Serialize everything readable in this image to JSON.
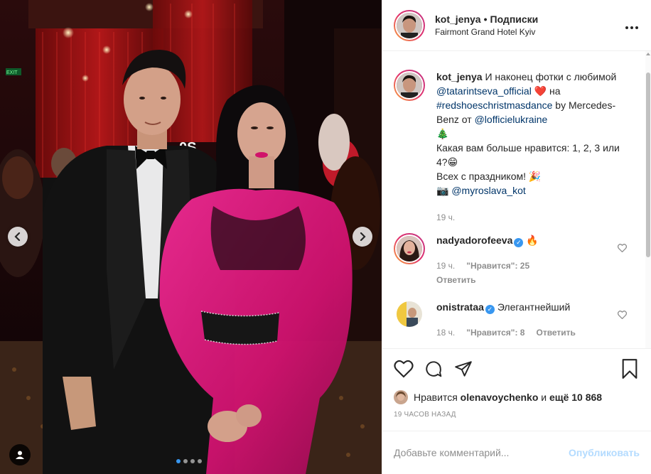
{
  "photo": {
    "alt_sign": "0S",
    "exit_sign": "EXIT",
    "carousel_dots": 4,
    "active_dot": 0
  },
  "header": {
    "username": "kot_jenya",
    "separator": "•",
    "follow_label": "Подписки",
    "location": "Fairmont Grand Hotel Kyiv",
    "more_icon": "more-dots-icon"
  },
  "caption": {
    "username": "kot_jenya",
    "text_1": "И наконец фотки с любимой ",
    "mention_1": "@tatarintseva_official",
    "heart": "❤️",
    "text_2": " на ",
    "hashtag": "#redshoeschristmasdance",
    "text_3": " by Mercedes-Benz от ",
    "mention_2": "@lofficielukraine",
    "tree": "🎄",
    "text_4": "Какая вам больше нравится: 1, 2, 3 или 4?",
    "grin": "😁",
    "text_5": "Всех с праздником! ",
    "confetti": "🎉",
    "camera": "📷 ",
    "mention_3": "@myroslava_kot",
    "time": "19 ч."
  },
  "comments": [
    {
      "username": "nadyadorofeeva",
      "verified": true,
      "text": "🔥",
      "time": "19 ч.",
      "likes_label": "\"Нравится\": 25",
      "reply_label": "Ответить"
    },
    {
      "username": "onistrataa",
      "verified": true,
      "text": "Элегантнейший",
      "time": "18 ч.",
      "likes_label": "\"Нравится\": 8",
      "reply_label": "Ответить"
    }
  ],
  "actions": {
    "like_icon": "heart-outline-icon",
    "comment_icon": "comment-bubble-icon",
    "share_icon": "paper-plane-icon",
    "save_icon": "bookmark-icon"
  },
  "likes": {
    "prefix": "Нравится ",
    "user": "olenavoychenko",
    "middle": " и ",
    "rest": "ещё 10 868"
  },
  "timestamp": "19 ЧАСОВ НАЗАД",
  "add_comment": {
    "placeholder": "Добавьте комментарий...",
    "publish_label": "Опубликовать"
  },
  "colors": {
    "link": "#003569",
    "verified": "#3897f0",
    "publish_disabled": "#b3dbff",
    "dress": "#e0157f"
  }
}
